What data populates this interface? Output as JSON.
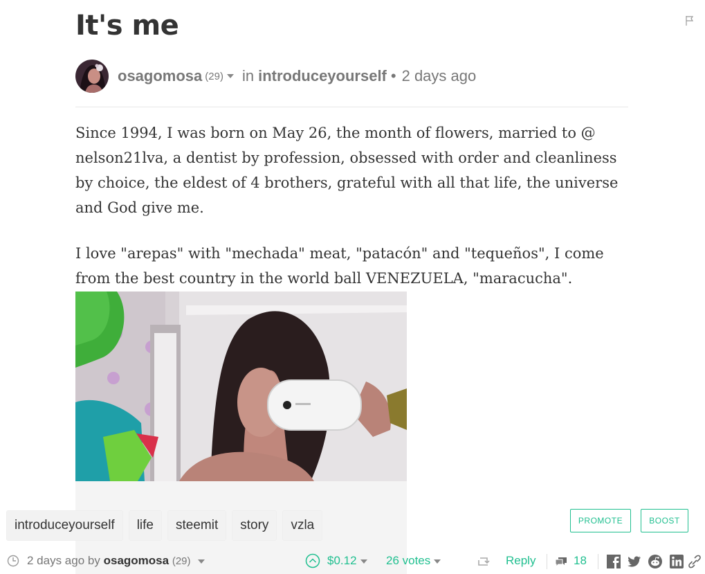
{
  "post": {
    "title": "It's me",
    "author": "osagomosa",
    "author_reputation": "(29)",
    "in_word": "in",
    "category": "introduceyourself",
    "separator": "•",
    "age": "2 days ago"
  },
  "body": {
    "paragraphs": [
      "Since 1994, I was born on May 26, the month of flowers, married to @ nelson21lva, a dentist by profession, obsessed with order and cleanliness by choice, the eldest of 4 brothers, grateful with all that life, the universe and God give me.",
      "I love \"arepas\" with \"mechada\" meat, \"patacón\" and \"tequeños\", I come from the best country in the world ball VENEZUELA, \"maracucha\"."
    ]
  },
  "tags": [
    "introduceyourself",
    "life",
    "steemit",
    "story",
    "vzla"
  ],
  "actions": {
    "promote_label": "PROMOTE",
    "boost_label": "BOOST"
  },
  "footer": {
    "time": "2 days ago",
    "by_word": "by",
    "author": "osagomosa",
    "reputation": "(29)",
    "payout": "$0.12",
    "votes": "26 votes",
    "reply_label": "Reply",
    "comments_count": "18"
  },
  "colors": {
    "accent": "#1fbf8f",
    "text": "#333333",
    "muted": "#777777"
  },
  "icons": [
    "flag-icon",
    "clock-icon",
    "upvote-icon",
    "resteem-icon",
    "comments-icon",
    "facebook-icon",
    "twitter-icon",
    "reddit-icon",
    "linkedin-icon",
    "link-icon"
  ]
}
